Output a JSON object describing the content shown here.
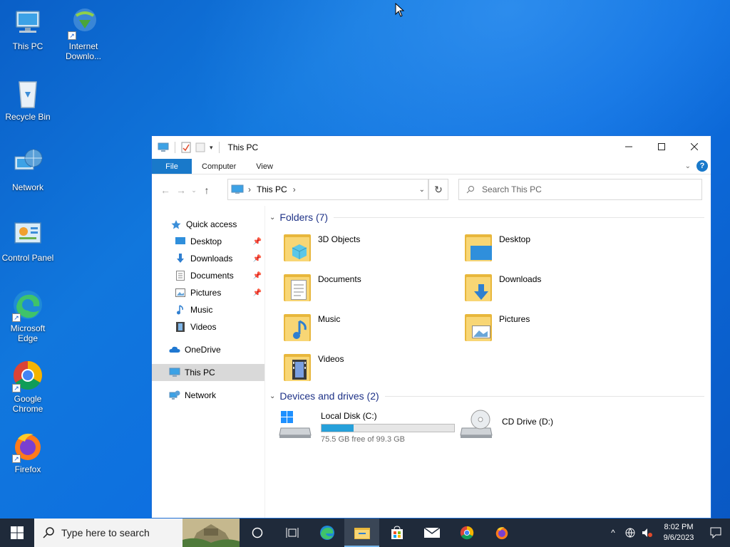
{
  "desktop": {
    "icons": [
      {
        "name": "This PC"
      },
      {
        "name": "Internet Downlo..."
      },
      {
        "name": "Recycle Bin"
      },
      {
        "name": "Network"
      },
      {
        "name": "Control Panel"
      },
      {
        "name": "Microsoft Edge"
      },
      {
        "name": "Google Chrome"
      },
      {
        "name": "Firefox"
      }
    ]
  },
  "window": {
    "title": "This PC",
    "ribbon_tabs": [
      "File",
      "Computer",
      "View"
    ],
    "address": {
      "crumb": "This PC"
    },
    "search": {
      "placeholder": "Search This PC"
    },
    "nav": {
      "quick_access": "Quick access",
      "quick_items": [
        "Desktop",
        "Downloads",
        "Documents",
        "Pictures",
        "Music",
        "Videos"
      ],
      "onedrive": "OneDrive",
      "this_pc": "This PC",
      "network": "Network"
    },
    "folders_header": "Folders (7)",
    "folders": [
      "3D Objects",
      "Desktop",
      "Documents",
      "Downloads",
      "Music",
      "Pictures",
      "Videos"
    ],
    "devices_header": "Devices and drives (2)",
    "drives": [
      {
        "name": "Local Disk (C:)",
        "free_text": "75.5 GB free of 99.3 GB",
        "used_fraction": 0.24
      },
      {
        "name": "CD Drive (D:)"
      }
    ]
  },
  "taskbar": {
    "search_placeholder": "Type here to search",
    "time": "8:02 PM",
    "date": "9/6/2023"
  },
  "colors": {
    "accent": "#1979ca",
    "folder": "#f8d675",
    "drive_fill": "#26a0da",
    "taskbar": "#1f2a3a"
  }
}
